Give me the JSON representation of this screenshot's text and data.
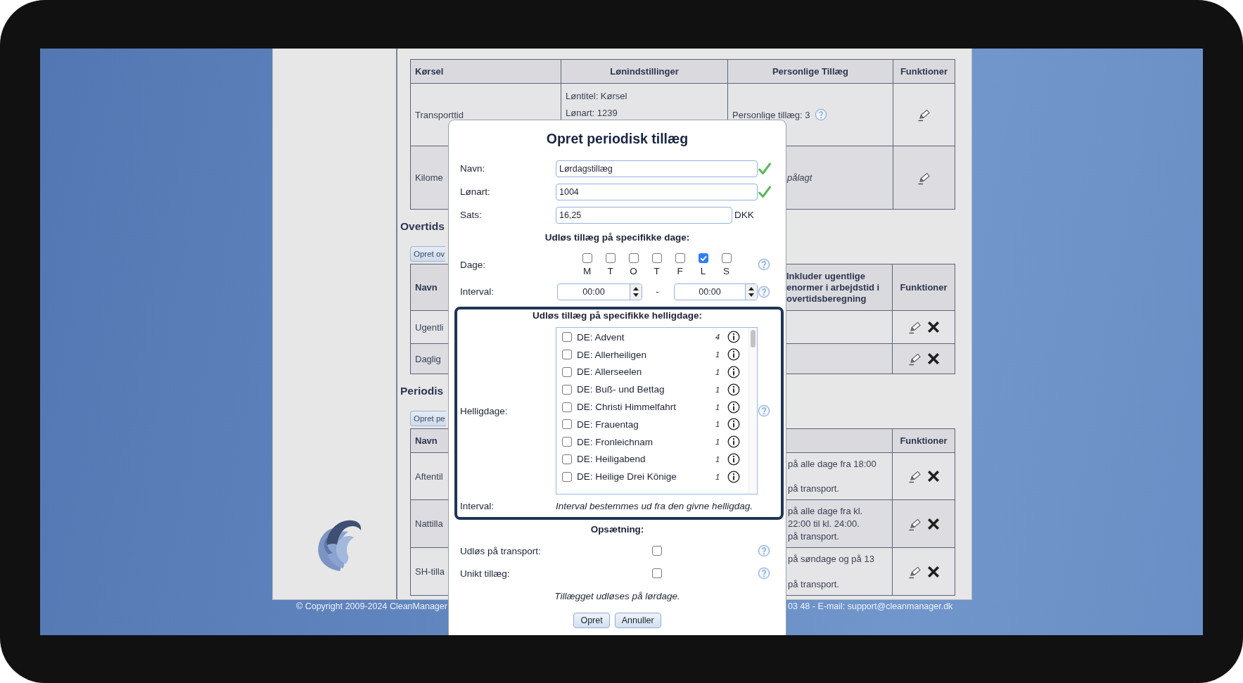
{
  "page": {
    "transport_table": {
      "columns": [
        "Kørsel",
        "Lønindstillinger",
        "Personlige Tillæg",
        "Funktioner"
      ],
      "rows": [
        {
          "name": "Transporttid",
          "settings": [
            "Løntitel: Kørsel",
            "Lønart: 1239"
          ],
          "personal": "Personlige tillæg: 3",
          "personal_italic": false,
          "personal_help": true,
          "editable": true,
          "deletable": false
        },
        {
          "name": "Kilome",
          "personal": "pålagt",
          "personal_italic": true,
          "personal_help": false,
          "editable": true,
          "deletable": false
        }
      ]
    },
    "overtime": {
      "heading": "Overtids",
      "button": "Opret ov",
      "columns": [
        "Navn",
        "Inkluder ugentlige\nenormer i arbejdstid i\novertidsberegning",
        "Funktioner"
      ],
      "rows": [
        {
          "name": "Ugentli",
          "editable": true,
          "deletable": true
        },
        {
          "name": "Daglig",
          "editable": true,
          "deletable": true
        }
      ]
    },
    "periodic": {
      "heading": "Periodis",
      "button": "Opret pe",
      "columns": [
        "Navn",
        "Funktioner"
      ],
      "rows": [
        {
          "name": "Aftentil",
          "description": [
            "på alle dage fra 18:00",
            "på transport."
          ],
          "editable": true,
          "deletable": true
        },
        {
          "name": "Nattilla",
          "description": [
            "på alle dage fra kl.",
            "22:00 til kl. 24:00.",
            "på transport."
          ],
          "editable": true,
          "deletable": true
        },
        {
          "name": "SH-tilla",
          "description": [
            "på søndage og på 13",
            "på transport."
          ],
          "editable": true,
          "deletable": true
        }
      ]
    }
  },
  "footer": {
    "copyright": "© Copyright 2009-2024 CleanManager",
    "contact": "03 48 - E-mail: support@cleanmanager.dk"
  },
  "dialog": {
    "title": "Opret periodisk tillæg",
    "fields": [
      {
        "label": "Navn:",
        "value": "Lørdagstillæg",
        "valid": true
      },
      {
        "label": "Lønart:",
        "value": "1004",
        "valid": true
      },
      {
        "label": "Sats:",
        "value": "16,25",
        "unit": "DKK",
        "valid": false
      }
    ],
    "days_heading": "Udløs tillæg på specifikke dage:",
    "days_label": "Dage:",
    "days": [
      {
        "letter": "M",
        "checked": false
      },
      {
        "letter": "T",
        "checked": false
      },
      {
        "letter": "O",
        "checked": false
      },
      {
        "letter": "T",
        "checked": false
      },
      {
        "letter": "F",
        "checked": false
      },
      {
        "letter": "L",
        "checked": true
      },
      {
        "letter": "S",
        "checked": false
      }
    ],
    "interval": {
      "label": "Interval:",
      "from": "00:00",
      "separator": "-",
      "to": "00:00"
    },
    "holidays": {
      "heading": "Udløs tillæg på specifikke helligdage:",
      "label": "Helligdage:",
      "items": [
        {
          "name": "DE: Advent",
          "count": "4",
          "checked": false
        },
        {
          "name": "DE: Allerheiligen",
          "count": "1",
          "checked": false
        },
        {
          "name": "DE: Allerseelen",
          "count": "1",
          "checked": false
        },
        {
          "name": "DE: Buß- und Bettag",
          "count": "1",
          "checked": false
        },
        {
          "name": "DE: Christi Himmelfahrt",
          "count": "1",
          "checked": false
        },
        {
          "name": "DE: Frauentag",
          "count": "1",
          "checked": false
        },
        {
          "name": "DE: Fronleichnam",
          "count": "1",
          "checked": false
        },
        {
          "name": "DE: Heiligabend",
          "count": "1",
          "checked": false
        },
        {
          "name": "DE: Heilige Drei Könige",
          "count": "1",
          "checked": false
        }
      ],
      "interval_label": "Interval:",
      "interval_note": "Interval bestemmes ud fra den givne helligdag."
    },
    "setup": {
      "heading": "Opsætning:",
      "options": [
        {
          "label": "Udløs på transport:",
          "checked": false
        },
        {
          "label": "Unikt tillæg:",
          "checked": false
        }
      ]
    },
    "summary": "Tillægget udløses på lørdage.",
    "buttons": [
      "Opret",
      "Annuller"
    ]
  }
}
